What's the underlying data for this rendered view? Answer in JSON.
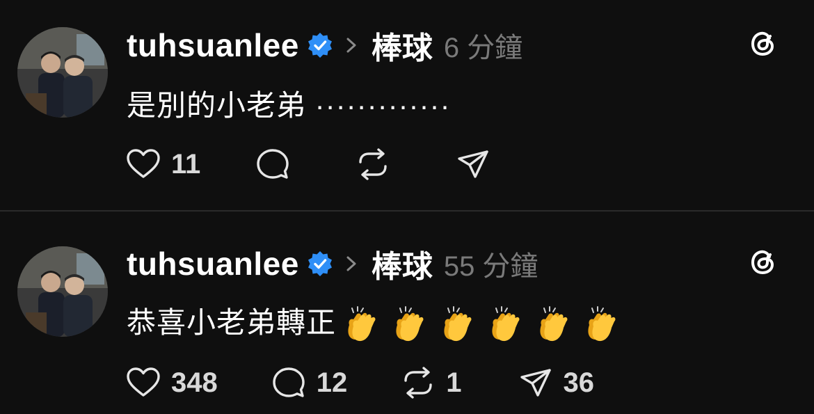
{
  "colors": {
    "background": "#0f0f0f",
    "verified": "#2f8ff7",
    "time": "#7a7a7a",
    "text": "#ffffff",
    "clap": "#ffc83d"
  },
  "posts": [
    {
      "username": "tuhsuanlee",
      "topic": "棒球",
      "time": "6 分鐘",
      "text": "是別的小老弟 ·············",
      "likes": "11",
      "replies": "",
      "reposts": "",
      "shares": "",
      "icons": [
        "heart-icon",
        "comment-icon",
        "repost-icon",
        "share-icon",
        "threads-logo-icon"
      ]
    },
    {
      "username": "tuhsuanlee",
      "topic": "棒球",
      "time": "55 分鐘",
      "text": "恭喜小老弟轉正",
      "emoji": "👏👏👏👏👏👏",
      "likes": "348",
      "replies": "12",
      "reposts": "1",
      "shares": "36",
      "icons": [
        "heart-icon",
        "comment-icon",
        "repost-icon",
        "share-icon",
        "threads-logo-icon"
      ]
    }
  ]
}
